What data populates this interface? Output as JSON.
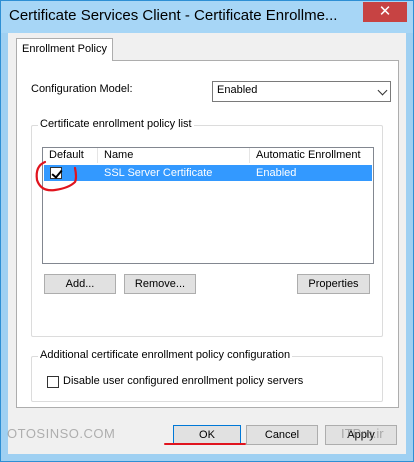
{
  "window": {
    "title": "Certificate Services Client - Certificate Enrollme...",
    "close_label": "✕"
  },
  "tabs": [
    {
      "label": "Enrollment Policy",
      "active": true
    }
  ],
  "config_model": {
    "label": "Configuration Model:",
    "selected": "Enabled"
  },
  "policy_list_group": {
    "caption": "Certificate enrollment policy list",
    "columns": [
      "Default",
      "Name",
      "Automatic Enrollment"
    ],
    "rows": [
      {
        "default_checked": true,
        "name": "SSL Server Certificate",
        "automatic_enrollment": "Enabled",
        "selected": true
      }
    ],
    "buttons": {
      "add": "Add...",
      "remove": "Remove...",
      "properties": "Properties"
    }
  },
  "additional_group": {
    "caption": "Additional certificate enrollment policy configuration",
    "disable_checkbox_label": "Disable user configured enrollment policy servers",
    "disable_checked": false
  },
  "dialog_buttons": {
    "ok": "OK",
    "cancel": "Cancel",
    "apply": "Apply"
  },
  "watermark": {
    "left": "OTOSINSO.COM",
    "right": "ITPro.ir"
  },
  "colors": {
    "titlebar": "#a7d6f6",
    "close_button": "#c74343",
    "selection": "#3399ff",
    "annotation_red": "#e0141e"
  }
}
